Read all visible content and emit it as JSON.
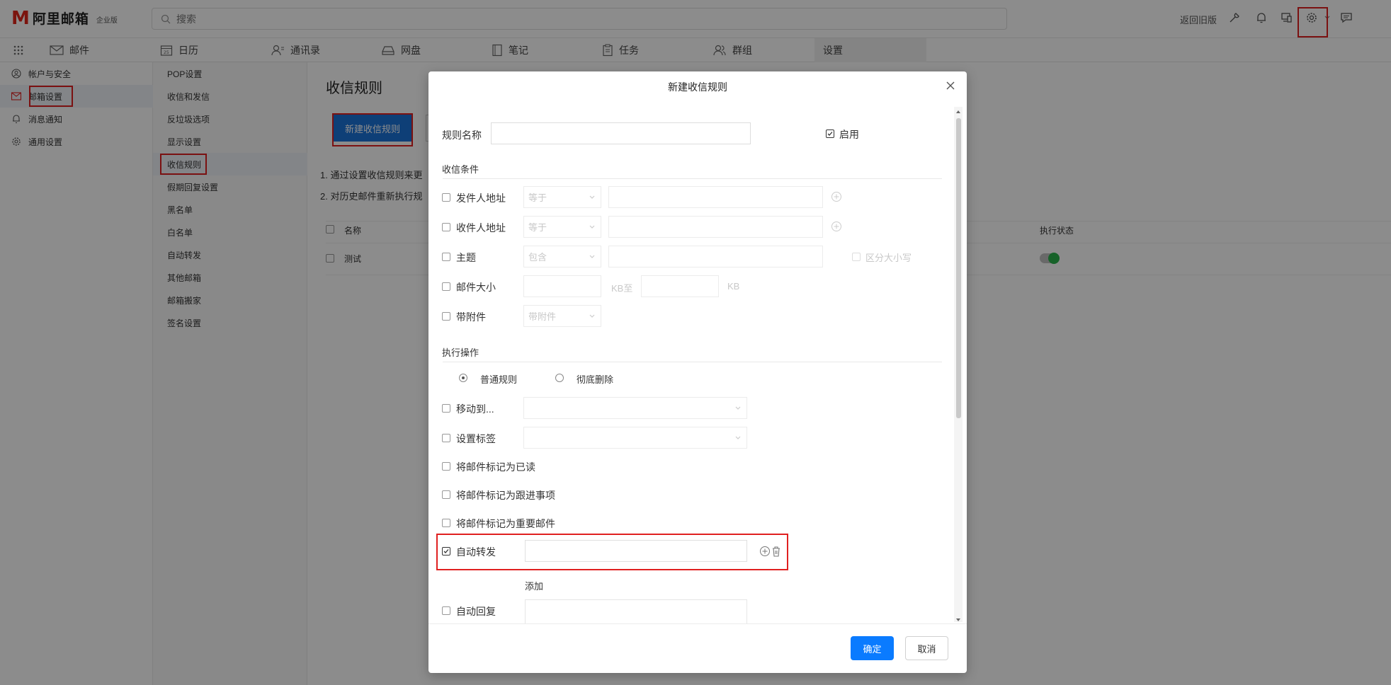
{
  "app": {
    "logo_mark": "M",
    "logo_name": "阿里邮箱",
    "edition": "企业版",
    "search_placeholder": "搜索",
    "return_old_label": "返回旧版",
    "icons": [
      "tools-icon",
      "bell-icon",
      "devices-icon",
      "gear-icon",
      "chat-icon"
    ]
  },
  "nav": {
    "tabs": [
      {
        "label": "邮件",
        "icon": "mail-icon"
      },
      {
        "label": "日历",
        "icon": "calendar-icon"
      },
      {
        "label": "通讯录",
        "icon": "contacts-icon"
      },
      {
        "label": "网盘",
        "icon": "drive-icon"
      },
      {
        "label": "笔记",
        "icon": "note-icon"
      },
      {
        "label": "任务",
        "icon": "task-icon"
      },
      {
        "label": "群组",
        "icon": "group-icon"
      },
      {
        "label": "设置",
        "icon": ""
      }
    ]
  },
  "sidebar": {
    "items": [
      {
        "label": "帐户与安全",
        "icon": "user-icon"
      },
      {
        "label": "邮箱设置",
        "icon": "mail-icon"
      },
      {
        "label": "消息通知",
        "icon": "bell-icon"
      },
      {
        "label": "通用设置",
        "icon": "gear-icon"
      }
    ]
  },
  "subnav": {
    "items": [
      "POP设置",
      "收信和发信",
      "反垃圾选项",
      "显示设置",
      "收信规则",
      "假期回复设置",
      "黑名单",
      "白名单",
      "自动转发",
      "其他邮箱",
      "邮箱搬家",
      "签名设置"
    ]
  },
  "main": {
    "title": "收信规则",
    "new_rule_label": "新建收信规则",
    "tip1": "1. 通过设置收信规则来更",
    "tip2": "2. 对历史邮件重新执行规",
    "col_name": "名称",
    "col_status": "执行状态",
    "rows": [
      {
        "name": "测试",
        "enabled": true
      }
    ]
  },
  "dialog": {
    "title": "新建收信规则",
    "rule_name_label": "规则名称",
    "rule_name_value": "",
    "enable_label": "启用",
    "conditions_title": "收信条件",
    "conditions": {
      "sender": {
        "label": "发件人地址",
        "op": "等于"
      },
      "recipient": {
        "label": "收件人地址",
        "op": "等于"
      },
      "subject": {
        "label": "主题",
        "op": "包含",
        "case_label": "区分大小写"
      },
      "size": {
        "label": "邮件大小",
        "unit1": "KB至",
        "unit2": "KB"
      },
      "attachment": {
        "label": "带附件",
        "op": "带附件"
      }
    },
    "actions_title": "执行操作",
    "radio_normal": "普通规则",
    "radio_delete": "彻底删除",
    "actions": {
      "move": "移动到...",
      "tag": "设置标签",
      "mark_read": "将邮件标记为已读",
      "mark_followup": "将邮件标记为跟进事项",
      "mark_important": "将邮件标记为重要邮件",
      "forward": "自动转发",
      "add": "添加",
      "auto_reply": "自动回复"
    },
    "ok_label": "确定",
    "cancel_label": "取消"
  }
}
